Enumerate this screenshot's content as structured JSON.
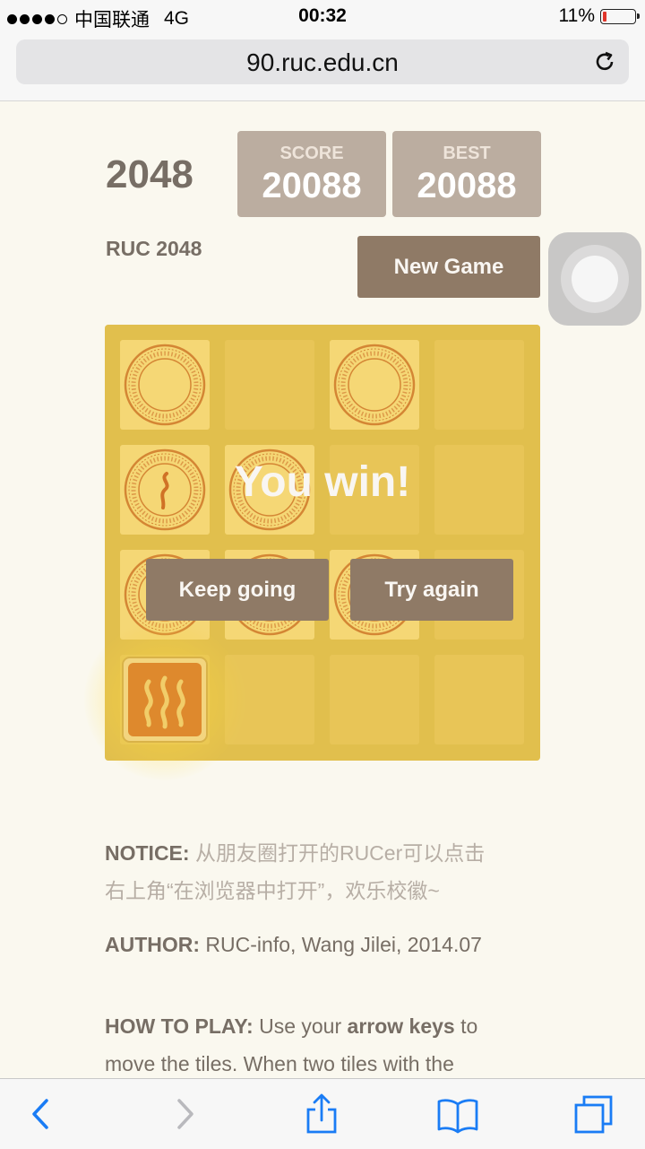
{
  "status_bar": {
    "carrier": "中国联通",
    "network": "4G",
    "time": "00:32",
    "battery_percent": "11%",
    "battery_level": 0.11
  },
  "browser": {
    "url": "90.ruc.edu.cn",
    "reload_icon": "reload-icon"
  },
  "game": {
    "title": "2048",
    "subtitle": "RUC 2048",
    "score_label": "SCORE",
    "score": "20088",
    "best_label": "BEST",
    "best": "20088",
    "new_game_label": "New Game",
    "win_message": "You win!",
    "keep_going_label": "Keep going",
    "try_again_label": "Try again",
    "tiles": [
      {
        "row": 0,
        "col": 0,
        "kind": "ruc-seal"
      },
      {
        "row": 0,
        "col": 2,
        "kind": "ruc-seal"
      },
      {
        "row": 1,
        "col": 0,
        "kind": "ruc-seal-red-mark"
      },
      {
        "row": 1,
        "col": 1,
        "kind": "ruc-seal"
      },
      {
        "row": 2,
        "col": 0,
        "kind": "ruc-seal"
      },
      {
        "row": 2,
        "col": 1,
        "kind": "ruc-seal"
      },
      {
        "row": 2,
        "col": 2,
        "kind": "ruc-seal"
      },
      {
        "row": 3,
        "col": 0,
        "kind": "orange-wave-badge"
      }
    ]
  },
  "notice": {
    "label": "NOTICE:",
    "text_line1": " 从朋友圈打开的RUCer可以点击",
    "text_line2": "右上角“在浏览器中打开”，欢乐校徽~"
  },
  "author": {
    "label": "AUTHOR:",
    "text": " RUC-info, Wang Jilei, 2014.07"
  },
  "how_to_play": {
    "label": "HOW TO PLAY:",
    "text_a": " Use your ",
    "keys": "arrow keys",
    "text_b": " to",
    "line2": "move the tiles. When two tiles with the"
  },
  "toolbar": {
    "icons": [
      "back-icon",
      "forward-icon",
      "share-icon",
      "bookmarks-icon",
      "tabs-icon"
    ]
  },
  "colors": {
    "page_bg": "#faf8ef",
    "text": "#776e65",
    "button": "#8f7a66",
    "score_box": "#bbada0",
    "board": "#d7bd66",
    "ios_blue": "#1a7cf5"
  }
}
